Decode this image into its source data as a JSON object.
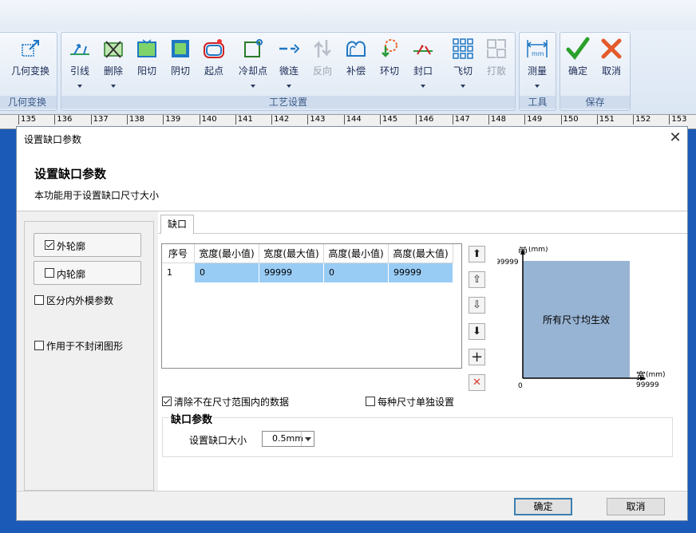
{
  "ribbon": {
    "buttons": [
      {
        "id": "geom",
        "label": "几何变换",
        "icon": "geometry-transform-icon",
        "disabled": false
      },
      {
        "id": "lead",
        "label": "引线",
        "icon": "lead-line-icon",
        "disabled": false
      },
      {
        "id": "delete",
        "label": "删除",
        "icon": "delete-icon",
        "disabled": false
      },
      {
        "id": "outer",
        "label": "阳切",
        "icon": "outer-cut-icon",
        "disabled": false
      },
      {
        "id": "inner",
        "label": "阴切",
        "icon": "inner-cut-icon",
        "disabled": false
      },
      {
        "id": "start",
        "label": "起点",
        "icon": "start-point-icon",
        "disabled": false
      },
      {
        "id": "cool",
        "label": "冷却点",
        "icon": "cooling-point-icon",
        "disabled": false
      },
      {
        "id": "micro",
        "label": "微连",
        "icon": "micro-joint-icon",
        "disabled": false
      },
      {
        "id": "reverse",
        "label": "反向",
        "icon": "reverse-icon",
        "disabled": true
      },
      {
        "id": "comp",
        "label": "补偿",
        "icon": "compensation-icon",
        "disabled": false
      },
      {
        "id": "ring",
        "label": "环切",
        "icon": "ring-cut-icon",
        "disabled": false
      },
      {
        "id": "seal",
        "label": "封口",
        "icon": "seal-icon",
        "disabled": false
      },
      {
        "id": "fly",
        "label": "飞切",
        "icon": "fly-cut-icon",
        "disabled": false
      },
      {
        "id": "scatter",
        "label": "打散",
        "icon": "scatter-icon",
        "disabled": true
      },
      {
        "id": "measure",
        "label": "测量",
        "icon": "measure-icon",
        "disabled": false
      },
      {
        "id": "ok",
        "label": "确定",
        "icon": "check-icon",
        "disabled": false
      },
      {
        "id": "cancel",
        "label": "取消",
        "icon": "cancel-x-icon",
        "disabled": false
      }
    ],
    "groups": {
      "geom": "几何变换",
      "process": "工艺设置",
      "tools": "工具",
      "save": "保存"
    }
  },
  "ruler": {
    "ticks": [
      "135",
      "136",
      "137",
      "138",
      "139",
      "140",
      "141",
      "142",
      "143",
      "144",
      "145",
      "146",
      "147",
      "148",
      "149",
      "150",
      "151",
      "152",
      "153"
    ]
  },
  "dialog": {
    "window_title": "设置缺口参数",
    "heading": "设置缺口参数",
    "subtitle": "本功能用于设置缺口尺寸大小",
    "left": {
      "outer_contour": {
        "label": "外轮廓",
        "checked": true
      },
      "inner_contour": {
        "label": "内轮廓",
        "checked": false
      },
      "distinguish_molds": {
        "label": "区分内外模参数",
        "checked": false
      },
      "open_shapes": {
        "label": "作用于不封闭图形",
        "checked": false
      }
    },
    "tab_label": "缺口",
    "table": {
      "columns": [
        "序号",
        "宽度(最小值)",
        "宽度(最大值)",
        "高度(最小值)",
        "高度(最大值)"
      ],
      "rows": [
        [
          "1",
          "0",
          "99999",
          "0",
          "99999"
        ]
      ]
    },
    "side_buttons": [
      "move-top-icon",
      "move-up-icon",
      "move-down-icon",
      "move-bottom-icon",
      "add-icon",
      "remove-icon"
    ],
    "clear_out_of_range": {
      "label": "清除不在尺寸范围内的数据",
      "checked": true
    },
    "per_size": {
      "label": "每种尺寸单独设置",
      "checked": false
    },
    "notch_group": {
      "title": "缺口参数",
      "size_label": "设置缺口大小",
      "size_value": "0.5mm"
    },
    "chart": {
      "y_label": "高",
      "y_unit": "(mm)",
      "x_label": "宽",
      "x_unit": "(mm)",
      "y_max": "99999",
      "x_max": "99999",
      "origin": "0",
      "region_text": "所有尺寸均生效",
      "region_color": "#98b4d4"
    },
    "ok_label": "确定",
    "cancel_label": "取消"
  }
}
